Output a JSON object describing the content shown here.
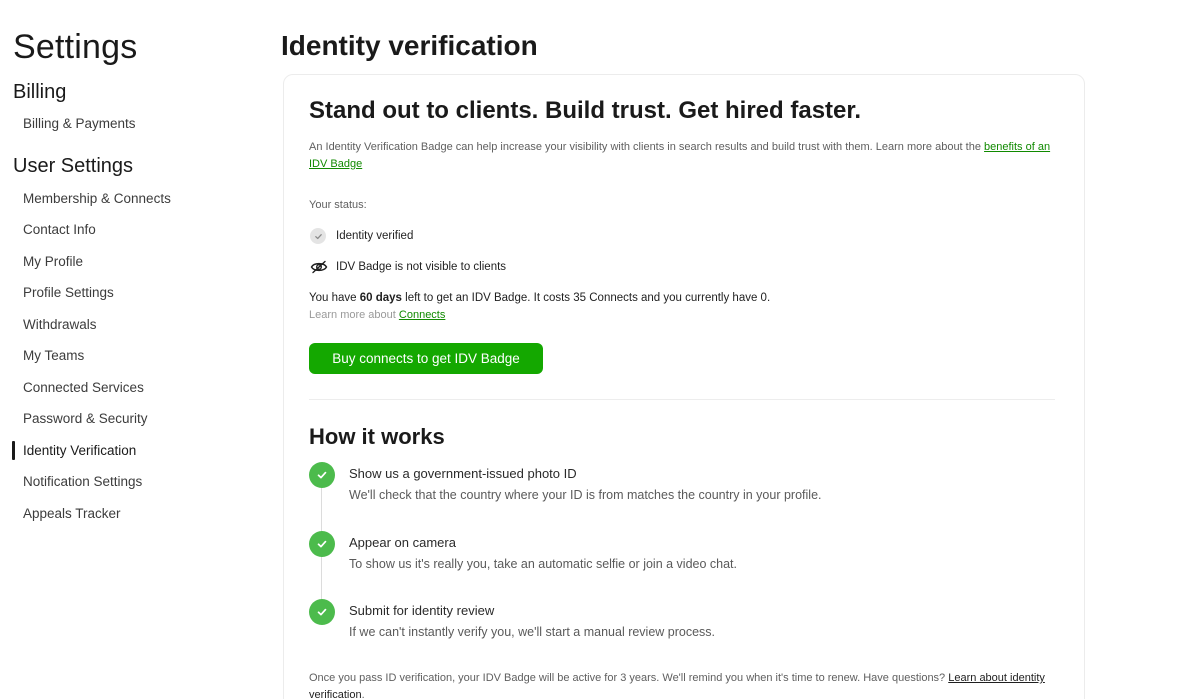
{
  "sidebar": {
    "title": "Settings",
    "billing_heading": "Billing",
    "billing_items": [
      {
        "label": "Billing & Payments"
      }
    ],
    "user_heading": "User Settings",
    "user_items": [
      {
        "label": "Membership & Connects"
      },
      {
        "label": "Contact Info"
      },
      {
        "label": "My Profile"
      },
      {
        "label": "Profile Settings"
      },
      {
        "label": "Withdrawals"
      },
      {
        "label": "My Teams"
      },
      {
        "label": "Connected Services"
      },
      {
        "label": "Password & Security"
      },
      {
        "label": "Identity Verification",
        "active": true
      },
      {
        "label": "Notification Settings"
      },
      {
        "label": "Appeals Tracker"
      }
    ]
  },
  "main": {
    "title": "Identity verification",
    "headline": "Stand out to clients. Build trust. Get hired faster.",
    "intro_text": "An Identity Verification Badge can help increase your visibility with clients in search results and build trust with them. Learn more about the ",
    "intro_link": "benefits of an IDV Badge",
    "status_label": "Your status:",
    "status_items": [
      {
        "icon": "check-icon",
        "label": "Identity verified"
      },
      {
        "icon": "eye-slash-icon",
        "label": "IDV Badge is not visible to clients"
      }
    ],
    "days_text": {
      "prefix": "You have ",
      "days": "60 days",
      "middle": " left to get an IDV Badge. It costs 35 Connects and you currently have 0."
    },
    "learn_more_prefix": "Learn more about ",
    "learn_more_link": "Connects",
    "cta_label": "Buy connects to get IDV Badge",
    "how_title": "How it works",
    "steps": [
      {
        "title": "Show us a government-issued photo ID",
        "desc": "We'll check that the country where your ID is from matches the country in your profile."
      },
      {
        "title": "Appear on camera",
        "desc": "To show us it's really you, take an automatic selfie or join a video chat."
      },
      {
        "title": "Submit for identity review",
        "desc": "If we can't instantly verify you, we'll start a manual review process."
      }
    ],
    "footer_text": "Once you pass ID verification, your IDV Badge will be active for 3 years. We'll remind you when it's time to renew. Have questions? ",
    "footer_link": "Learn about identity verification",
    "footer_end": "."
  },
  "colors": {
    "accent_green": "#14a800",
    "link_green": "#108a00",
    "step_green": "#4cbb4c"
  }
}
